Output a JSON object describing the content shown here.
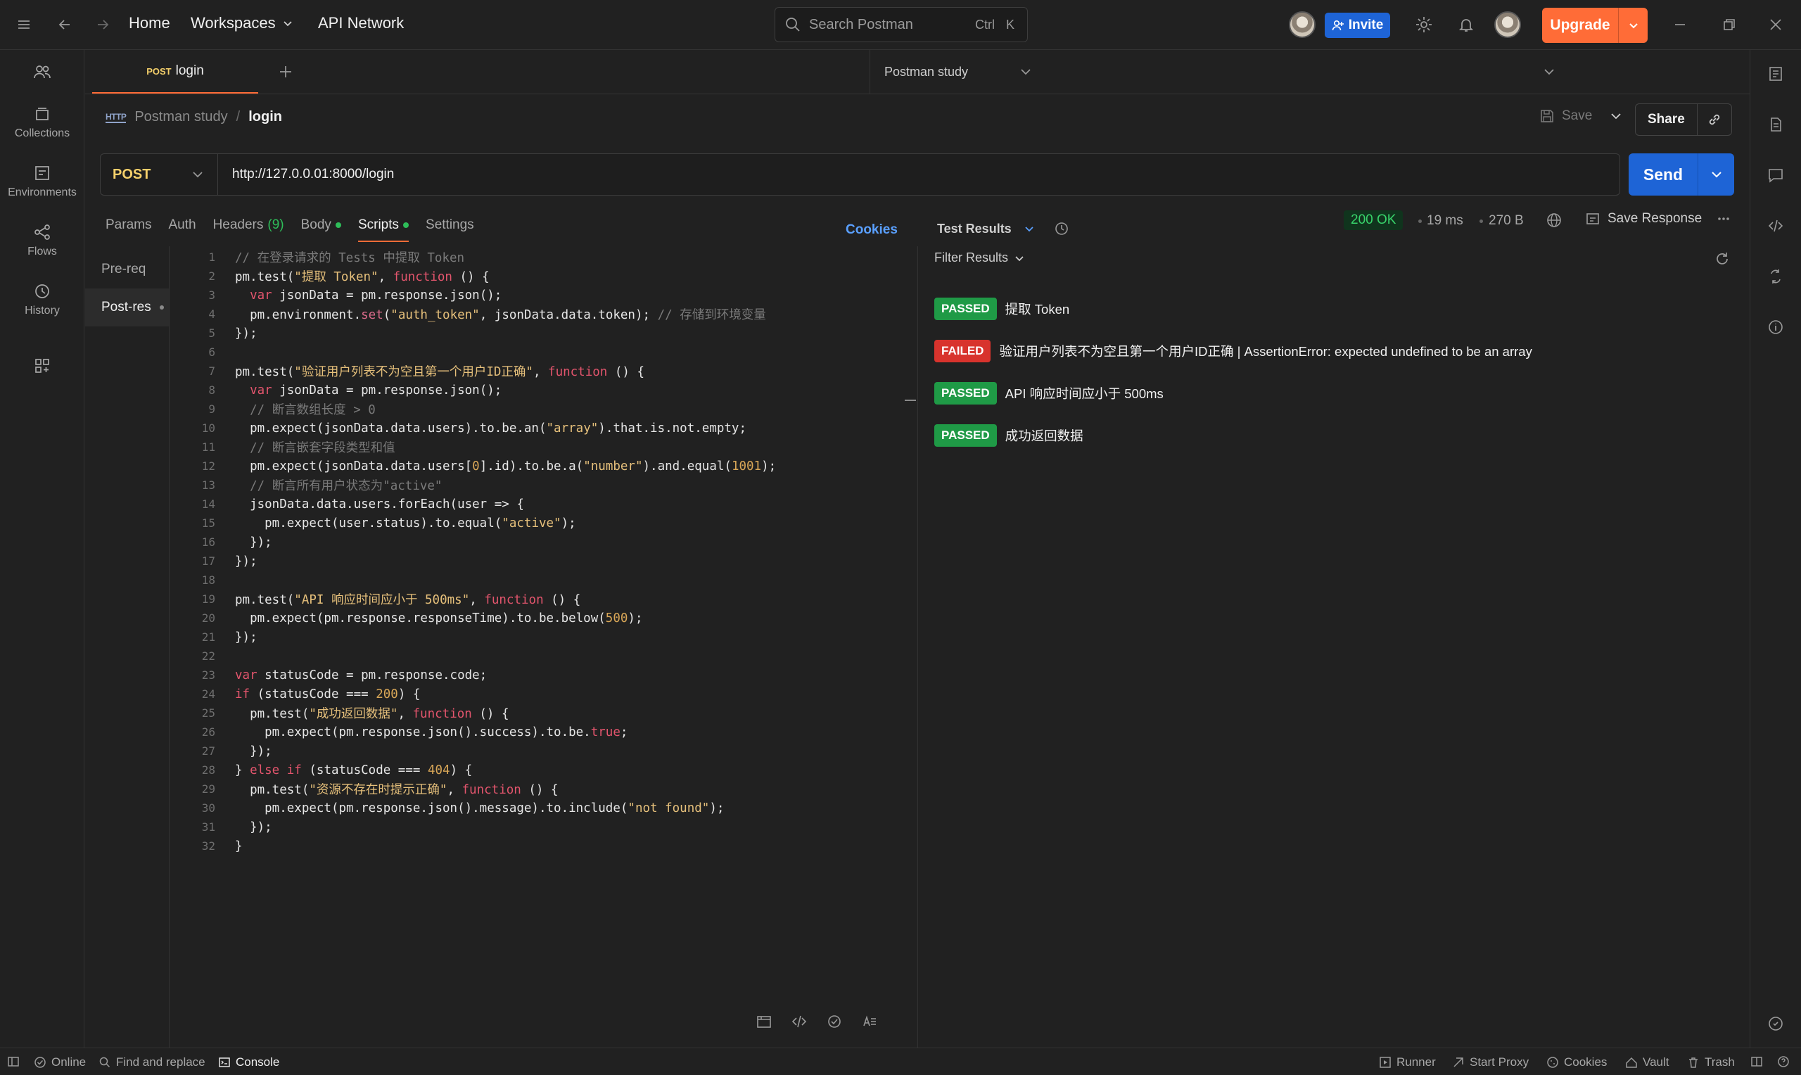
{
  "topbar": {
    "home": "Home",
    "workspaces": "Workspaces",
    "api_network": "API Network",
    "search_placeholder": "Search Postman",
    "search_kbd_ctrl": "Ctrl",
    "search_kbd_k": "K",
    "invite": "Invite",
    "upgrade": "Upgrade"
  },
  "sidebar": {
    "items": [
      {
        "label": "Collections",
        "icon": "collections-icon"
      },
      {
        "label": "Environments",
        "icon": "environments-icon"
      },
      {
        "label": "Flows",
        "icon": "flows-icon"
      },
      {
        "label": "History",
        "icon": "history-icon"
      }
    ]
  },
  "tabs": {
    "active_method": "POST",
    "active_name": "login"
  },
  "environment": {
    "selected": "Postman study"
  },
  "breadcrumb": {
    "badge": "HTTP",
    "collection": "Postman study",
    "separator": "/",
    "request": "login"
  },
  "actions": {
    "save": "Save",
    "share": "Share"
  },
  "request": {
    "method": "POST",
    "url": "http://127.0.0.01:8000/login",
    "send": "Send"
  },
  "request_tabs": [
    {
      "label": "Params"
    },
    {
      "label": "Auth"
    },
    {
      "label": "Headers",
      "count": "(9)"
    },
    {
      "label": "Body"
    },
    {
      "label": "Scripts"
    },
    {
      "label": "Settings"
    }
  ],
  "cookies_link": "Cookies",
  "scripts": {
    "items": [
      {
        "label": "Pre-req"
      },
      {
        "label": "Post-res"
      }
    ]
  },
  "code_lines": [
    {
      "n": "1",
      "tokens": [
        {
          "t": "// 在登录请求的 Tests 中提取 Token",
          "c": "cmt"
        }
      ]
    },
    {
      "n": "2",
      "tokens": [
        {
          "t": "pm.test(",
          "c": ""
        },
        {
          "t": "\"提取 Token\"",
          "c": "str"
        },
        {
          "t": ", ",
          "c": ""
        },
        {
          "t": "function",
          "c": "kw"
        },
        {
          "t": " () {",
          "c": ""
        }
      ]
    },
    {
      "n": "3",
      "tokens": [
        {
          "t": "  ",
          "c": ""
        },
        {
          "t": "var",
          "c": "kw"
        },
        {
          "t": " jsonData = pm.response.json();",
          "c": ""
        }
      ]
    },
    {
      "n": "4",
      "tokens": [
        {
          "t": "  pm.environment.",
          "c": ""
        },
        {
          "t": "set",
          "c": "fn"
        },
        {
          "t": "(",
          "c": ""
        },
        {
          "t": "\"auth_token\"",
          "c": "str"
        },
        {
          "t": ", jsonData.data.token); ",
          "c": ""
        },
        {
          "t": "// 存储到环境变量",
          "c": "cmt"
        }
      ]
    },
    {
      "n": "5",
      "tokens": [
        {
          "t": "});",
          "c": ""
        }
      ]
    },
    {
      "n": "6",
      "tokens": [
        {
          "t": "",
          "c": ""
        }
      ]
    },
    {
      "n": "7",
      "tokens": [
        {
          "t": "pm.test(",
          "c": ""
        },
        {
          "t": "\"验证用户列表不为空且第一个用户ID正确\"",
          "c": "str"
        },
        {
          "t": ", ",
          "c": ""
        },
        {
          "t": "function",
          "c": "kw"
        },
        {
          "t": " () {",
          "c": ""
        }
      ]
    },
    {
      "n": "8",
      "tokens": [
        {
          "t": "  ",
          "c": ""
        },
        {
          "t": "var",
          "c": "kw"
        },
        {
          "t": " jsonData = pm.response.json();",
          "c": ""
        }
      ]
    },
    {
      "n": "9",
      "tokens": [
        {
          "t": "  // 断言数组长度 > 0",
          "c": "cmt"
        }
      ]
    },
    {
      "n": "10",
      "tokens": [
        {
          "t": "  pm.expect(jsonData.data.users).to.be.an(",
          "c": ""
        },
        {
          "t": "\"array\"",
          "c": "str"
        },
        {
          "t": ").that.is.not.empty;",
          "c": ""
        }
      ]
    },
    {
      "n": "11",
      "tokens": [
        {
          "t": "  // 断言嵌套字段类型和值",
          "c": "cmt"
        }
      ]
    },
    {
      "n": "12",
      "tokens": [
        {
          "t": "  pm.expect(jsonData.data.users[",
          "c": ""
        },
        {
          "t": "0",
          "c": "num"
        },
        {
          "t": "].id).to.be.a(",
          "c": ""
        },
        {
          "t": "\"number\"",
          "c": "str"
        },
        {
          "t": ").and.equal(",
          "c": ""
        },
        {
          "t": "1001",
          "c": "num"
        },
        {
          "t": ");",
          "c": ""
        }
      ]
    },
    {
      "n": "13",
      "tokens": [
        {
          "t": "  // 断言所有用户状态为\"active\"",
          "c": "cmt"
        }
      ]
    },
    {
      "n": "14",
      "tokens": [
        {
          "t": "  jsonData.data.users.forEach(user => {",
          "c": ""
        }
      ]
    },
    {
      "n": "15",
      "tokens": [
        {
          "t": "    pm.expect(user.status).to.equal(",
          "c": ""
        },
        {
          "t": "\"active\"",
          "c": "str"
        },
        {
          "t": ");",
          "c": ""
        }
      ]
    },
    {
      "n": "16",
      "tokens": [
        {
          "t": "  });",
          "c": ""
        }
      ]
    },
    {
      "n": "17",
      "tokens": [
        {
          "t": "});",
          "c": ""
        }
      ]
    },
    {
      "n": "18",
      "tokens": [
        {
          "t": "",
          "c": ""
        }
      ]
    },
    {
      "n": "19",
      "tokens": [
        {
          "t": "pm.test(",
          "c": ""
        },
        {
          "t": "\"API 响应时间应小于 500ms\"",
          "c": "str"
        },
        {
          "t": ", ",
          "c": ""
        },
        {
          "t": "function",
          "c": "kw"
        },
        {
          "t": " () {",
          "c": ""
        }
      ]
    },
    {
      "n": "20",
      "tokens": [
        {
          "t": "  pm.expect(pm.response.responseTime).to.be.below(",
          "c": ""
        },
        {
          "t": "500",
          "c": "num"
        },
        {
          "t": ");",
          "c": ""
        }
      ]
    },
    {
      "n": "21",
      "tokens": [
        {
          "t": "});",
          "c": ""
        }
      ]
    },
    {
      "n": "22",
      "tokens": [
        {
          "t": "",
          "c": ""
        }
      ]
    },
    {
      "n": "23",
      "tokens": [
        {
          "t": "var",
          "c": "kw"
        },
        {
          "t": " statusCode = pm.response.code;",
          "c": ""
        }
      ]
    },
    {
      "n": "24",
      "tokens": [
        {
          "t": "if",
          "c": "kw"
        },
        {
          "t": " (statusCode === ",
          "c": ""
        },
        {
          "t": "200",
          "c": "num"
        },
        {
          "t": ") {",
          "c": ""
        }
      ]
    },
    {
      "n": "25",
      "tokens": [
        {
          "t": "  pm.test(",
          "c": ""
        },
        {
          "t": "\"成功返回数据\"",
          "c": "str"
        },
        {
          "t": ", ",
          "c": ""
        },
        {
          "t": "function",
          "c": "kw"
        },
        {
          "t": " () {",
          "c": ""
        }
      ]
    },
    {
      "n": "26",
      "tokens": [
        {
          "t": "    pm.expect(pm.response.json().success).to.be.",
          "c": ""
        },
        {
          "t": "true",
          "c": "kw"
        },
        {
          "t": ";",
          "c": ""
        }
      ]
    },
    {
      "n": "27",
      "tokens": [
        {
          "t": "  });",
          "c": ""
        }
      ]
    },
    {
      "n": "28",
      "tokens": [
        {
          "t": "} ",
          "c": ""
        },
        {
          "t": "else if",
          "c": "kw"
        },
        {
          "t": " (statusCode === ",
          "c": ""
        },
        {
          "t": "404",
          "c": "num"
        },
        {
          "t": ") {",
          "c": ""
        }
      ]
    },
    {
      "n": "29",
      "tokens": [
        {
          "t": "  pm.test(",
          "c": ""
        },
        {
          "t": "\"资源不存在时提示正确\"",
          "c": "str"
        },
        {
          "t": ", ",
          "c": ""
        },
        {
          "t": "function",
          "c": "kw"
        },
        {
          "t": " () {",
          "c": ""
        }
      ]
    },
    {
      "n": "30",
      "tokens": [
        {
          "t": "    pm.expect(pm.response.json().message).to.include(",
          "c": ""
        },
        {
          "t": "\"not found\"",
          "c": "str"
        },
        {
          "t": ");",
          "c": ""
        }
      ]
    },
    {
      "n": "31",
      "tokens": [
        {
          "t": "  });",
          "c": ""
        }
      ]
    },
    {
      "n": "32",
      "tokens": [
        {
          "t": "}",
          "c": ""
        }
      ]
    }
  ],
  "response": {
    "panel_title": "Test Results",
    "status": "200 OK",
    "time": "19 ms",
    "size": "270 B",
    "save_response": "Save Response",
    "filter": "Filter Results"
  },
  "test_results": [
    {
      "status": "PASSED",
      "text": "提取 Token"
    },
    {
      "status": "FAILED",
      "text": "验证用户列表不为空且第一个用户ID正确 | AssertionError: expected undefined to be an array"
    },
    {
      "status": "PASSED",
      "text": "API 响应时间应小于 500ms"
    },
    {
      "status": "PASSED",
      "text": "成功返回数据"
    }
  ],
  "statusbar": {
    "online": "Online",
    "find_replace": "Find and replace",
    "console": "Console",
    "runner": "Runner",
    "start_proxy": "Start Proxy",
    "cookies": "Cookies",
    "vault": "Vault",
    "trash": "Trash"
  },
  "colors": {
    "accent": "#ff6c37",
    "primary": "#1e64d6",
    "passed": "#1f9a46",
    "failed": "#d8332d",
    "method_post": "#f5d06b"
  }
}
